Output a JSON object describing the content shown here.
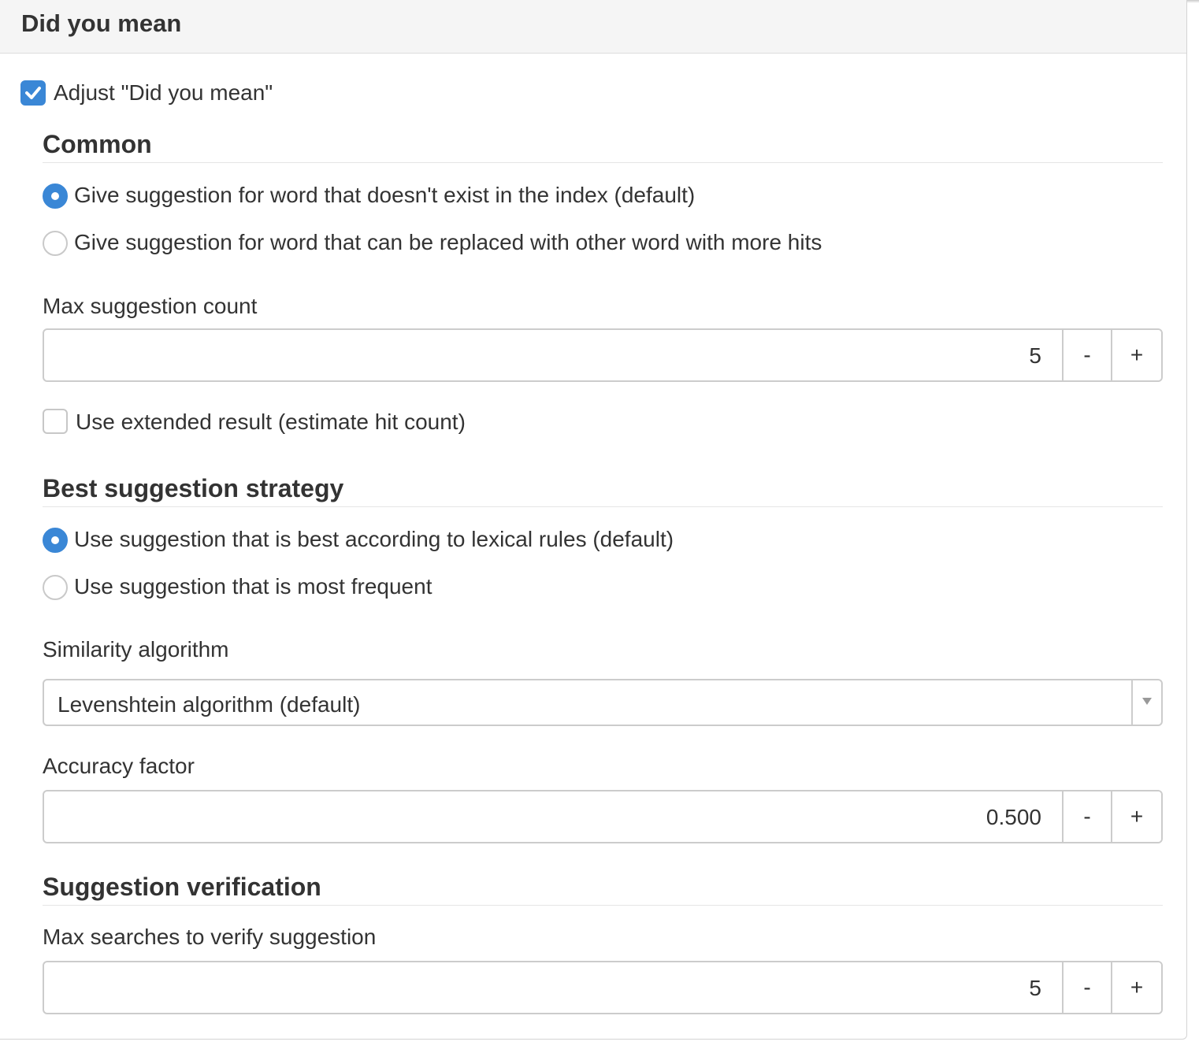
{
  "panel": {
    "title": "Did you mean"
  },
  "adjust": {
    "label": "Adjust \"Did you mean\"",
    "checked": true
  },
  "common": {
    "heading": "Common",
    "options": [
      {
        "label": "Give suggestion for word that doesn't exist in the index (default)",
        "selected": true
      },
      {
        "label": "Give suggestion for word that can be replaced with other word with more hits",
        "selected": false
      }
    ],
    "max_count": {
      "label": "Max suggestion count",
      "value": "5",
      "minus": "-",
      "plus": "+"
    },
    "extended": {
      "label": "Use extended result (estimate hit count)",
      "checked": false
    }
  },
  "strategy": {
    "heading": "Best suggestion strategy",
    "options": [
      {
        "label": "Use suggestion that is best according to lexical rules (default)",
        "selected": true
      },
      {
        "label": "Use suggestion that is most frequent",
        "selected": false
      }
    ],
    "similarity": {
      "label": "Similarity algorithm",
      "value": "Levenshtein algorithm (default)"
    },
    "accuracy": {
      "label": "Accuracy factor",
      "value": "0.500",
      "minus": "-",
      "plus": "+"
    }
  },
  "verification": {
    "heading": "Suggestion verification",
    "max_searches": {
      "label": "Max searches to verify suggestion",
      "value": "5",
      "minus": "-",
      "plus": "+"
    }
  },
  "colors": {
    "accent": "#3a87d6",
    "header_bg": "#f5f5f5",
    "border": "#cccccc"
  }
}
